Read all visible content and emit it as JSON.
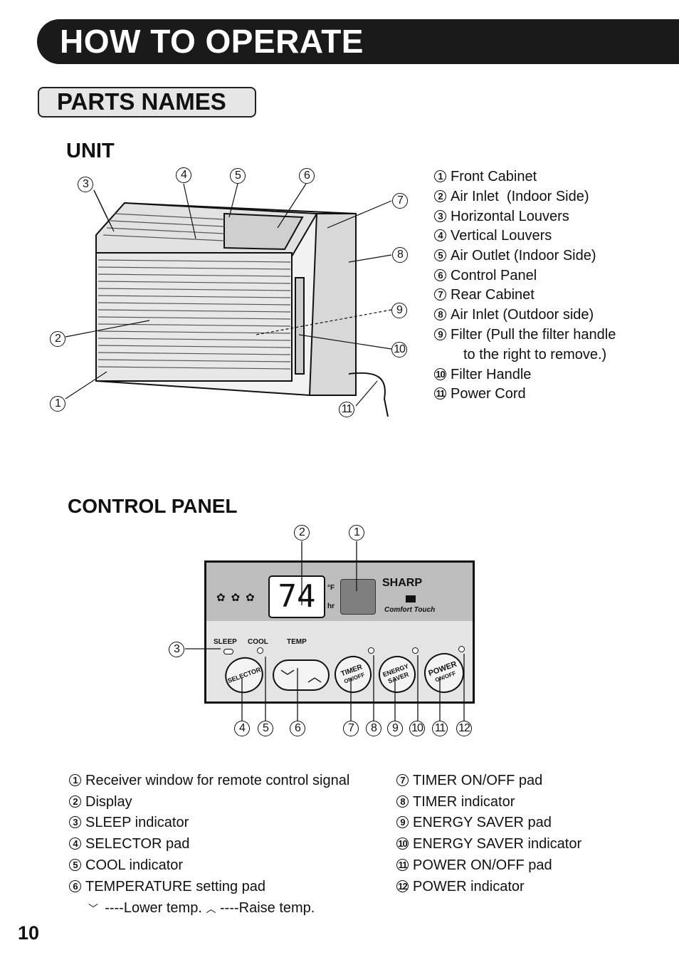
{
  "header": {
    "title": "HOW TO OPERATE"
  },
  "section": {
    "title": "PARTS NAMES"
  },
  "unit": {
    "title": "UNIT",
    "parts": [
      {
        "n": "1",
        "label": "Front Cabinet"
      },
      {
        "n": "2",
        "label": "Air Inlet  (Indoor Side)"
      },
      {
        "n": "3",
        "label": "Horizontal Louvers"
      },
      {
        "n": "4",
        "label": "Vertical Louvers"
      },
      {
        "n": "5",
        "label": "Air Outlet (Indoor Side)"
      },
      {
        "n": "6",
        "label": "Control Panel"
      },
      {
        "n": "7",
        "label": "Rear Cabinet"
      },
      {
        "n": "8",
        "label": "Air Inlet (Outdoor side)"
      },
      {
        "n": "9",
        "label": "Filter (Pull the filter handle",
        "cont": "to the right to remove.)"
      },
      {
        "n": "10",
        "label": "Filter Handle"
      },
      {
        "n": "11",
        "label": "Power Cord"
      }
    ]
  },
  "control_panel": {
    "title": "CONTROL PANEL",
    "display_value": "74",
    "unit_f": "°F",
    "unit_hr": "hr",
    "brand": "SHARP",
    "brand_sub": "Comfort Touch",
    "labels": {
      "sleep": "SLEEP",
      "cool": "COOL",
      "temp": "TEMP"
    },
    "pads": {
      "selector": "SELECTOR",
      "timer": "TIMER",
      "timer_sub": "ON/OFF",
      "energy": "ENERGY",
      "energy_sub": "SAVER",
      "power": "POWER",
      "power_sub": "ON/OFF"
    },
    "parts_left": [
      {
        "n": "1",
        "label": "Receiver window for remote control signal"
      },
      {
        "n": "2",
        "label": "Display"
      },
      {
        "n": "3",
        "label": "SLEEP indicator"
      },
      {
        "n": "4",
        "label": "SELECTOR pad"
      },
      {
        "n": "5",
        "label": "COOL indicator"
      },
      {
        "n": "6",
        "label": "TEMPERATURE setting pad"
      }
    ],
    "temp_note": {
      "lower": "----Lower temp.",
      "raise": "----Raise temp."
    },
    "parts_right": [
      {
        "n": "7",
        "label": "TIMER ON/OFF pad"
      },
      {
        "n": "8",
        "label": "TIMER indicator"
      },
      {
        "n": "9",
        "label": "ENERGY SAVER pad"
      },
      {
        "n": "10",
        "label": "ENERGY SAVER indicator"
      },
      {
        "n": "11",
        "label": "POWER ON/OFF pad"
      },
      {
        "n": "12",
        "label": "POWER indicator"
      }
    ]
  },
  "page_number": "10"
}
